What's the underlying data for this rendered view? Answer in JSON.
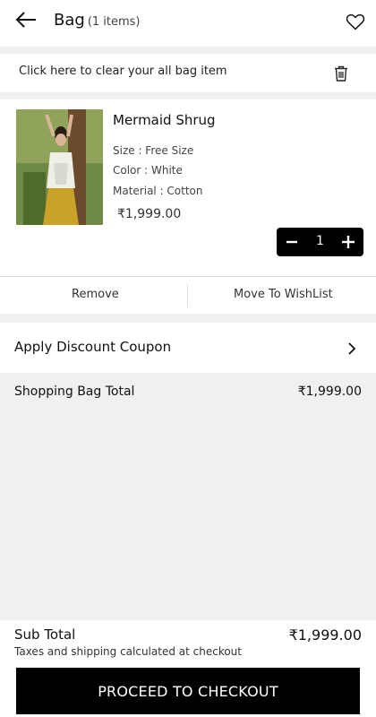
{
  "header": {
    "title": "Bag",
    "count": "(1 items)"
  },
  "clear_bar": {
    "text": "Click here to clear your all bag item"
  },
  "item": {
    "name": "Mermaid Shrug",
    "size": "Size : Free Size",
    "color": "Color : White",
    "material": "Material : Cotton",
    "price": "₹1,999.00",
    "quantity": "1",
    "actions": {
      "remove": "Remove",
      "wishlist": "Move To WishList"
    }
  },
  "coupon": {
    "label": "Apply Discount Coupon"
  },
  "bag_total": {
    "label": "Shopping Bag Total",
    "value": "₹1,999.00"
  },
  "footer": {
    "subtotal_label": "Sub Total",
    "subtotal_value": "₹1,999.00",
    "tax_note": "Taxes and shipping calculated at checkout",
    "checkout_label": "PROCEED TO CHECKOUT"
  },
  "icons": {
    "back": "arrow-left-icon",
    "wishlist": "heart-icon",
    "clear": "trash-icon",
    "coupon": "chevron-right-icon"
  }
}
